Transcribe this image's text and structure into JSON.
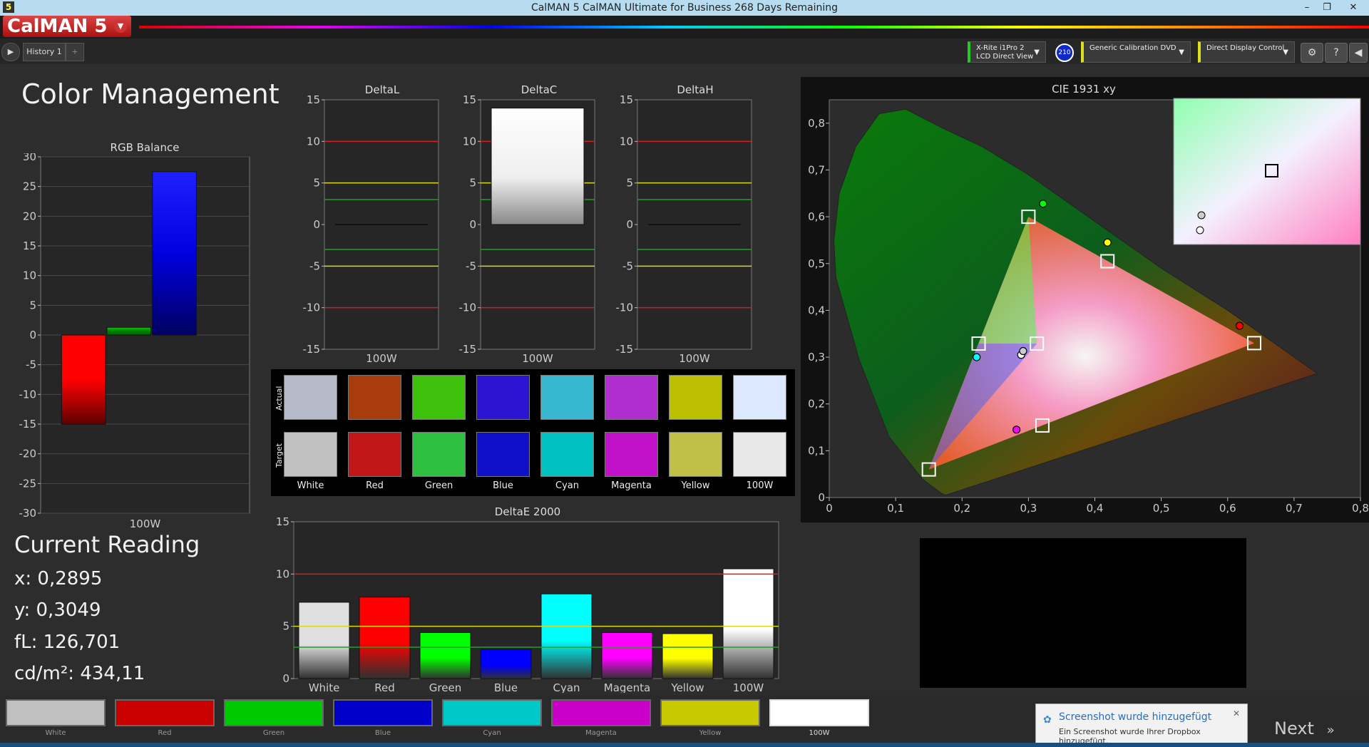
{
  "window": {
    "title": "CalMAN 5 CalMAN Ultimate for Business 268 Days Remaining",
    "app_icon": "5",
    "minimize": "–",
    "restore": "❐",
    "close": "✕"
  },
  "brand": {
    "logo": "CalMAN 5"
  },
  "tabs": {
    "history": "History 1",
    "add": "+"
  },
  "devices": [
    {
      "line1": "X-Rite i1Pro 2",
      "line2": "LCD Direct View",
      "accent": "#22cc22"
    },
    {
      "line1": "Generic Calibration DVD",
      "line2": "",
      "accent": "#dddd22"
    },
    {
      "line1": "Direct Display Control",
      "line2": "",
      "accent": "#dddd22"
    }
  ],
  "badge": "210",
  "page_title": "Color Management",
  "rgb_balance": {
    "title": "RGB Balance",
    "xlabel": "100W",
    "yticks": [
      "30",
      "25",
      "20",
      "15",
      "10",
      "5",
      "0",
      "-5",
      "-10",
      "-15",
      "-20",
      "-25",
      "-30"
    ]
  },
  "delta_charts": [
    {
      "title": "DeltaL",
      "xlabel": "100W"
    },
    {
      "title": "DeltaC",
      "xlabel": "100W"
    },
    {
      "title": "DeltaH",
      "xlabel": "100W"
    }
  ],
  "delta_yticks": [
    "15",
    "10",
    "5",
    "0",
    "-5",
    "-10",
    "-15"
  ],
  "swatch_rows": {
    "actual": "Actual",
    "target": "Target"
  },
  "swatches": [
    {
      "label": "White",
      "actual": "#b4bac8",
      "target": "#c0c0c0"
    },
    {
      "label": "Red",
      "actual": "#a83c0a",
      "target": "#c01818"
    },
    {
      "label": "Green",
      "actual": "#3ec20c",
      "target": "#2ec040"
    },
    {
      "label": "Blue",
      "actual": "#2a14d2",
      "target": "#1010c8"
    },
    {
      "label": "Cyan",
      "actual": "#38b8d0",
      "target": "#00c0c0"
    },
    {
      "label": "Magenta",
      "actual": "#b02ed0",
      "target": "#c010c8"
    },
    {
      "label": "Yellow",
      "actual": "#bcc000",
      "target": "#c0c048"
    },
    {
      "label": "100W",
      "actual": "#dce8ff",
      "target": "#e8e8e8"
    }
  ],
  "deltae": {
    "title": "DeltaE 2000",
    "yticks": [
      "15",
      "10",
      "5",
      "0"
    ]
  },
  "current_reading": {
    "title": "Current Reading",
    "x": "x: 0,2895",
    "y": "y: 0,3049",
    "fl": "fL: 126,701",
    "cdm2": "cd/m²: 434,11"
  },
  "cie": {
    "title": "CIE 1931 xy",
    "xticks": [
      "0",
      "0,1",
      "0,2",
      "0,3",
      "0,4",
      "0,5",
      "0,6",
      "0,7",
      "0,8"
    ],
    "yticks": [
      "0,8",
      "0,7",
      "0,6",
      "0,5",
      "0,4",
      "0,3",
      "0,2",
      "0,1",
      "0"
    ]
  },
  "footer_labels": [
    "White",
    "Red",
    "Green",
    "Blue",
    "Cyan",
    "Magenta",
    "Yellow",
    "100W"
  ],
  "footer_colors": [
    "#c0c0c0",
    "#c80000",
    "#00c800",
    "#0000c8",
    "#00c8c8",
    "#c800c8",
    "#c8c800",
    "#ffffff"
  ],
  "toast": {
    "title": "Screenshot wurde hinzugefügt",
    "body": "Ein Screenshot wurde Ihrer Dropbox hinzugefügt."
  },
  "next": "Next",
  "chart_data": [
    {
      "type": "bar",
      "title": "RGB Balance",
      "categories": [
        "100W"
      ],
      "series": [
        {
          "values": [
            -15
          ]
        },
        {
          "values": [
            1.3
          ]
        },
        {
          "values": [
            27.5
          ]
        }
      ],
      "series_colors": [
        "#ff0000",
        "#00a000",
        "#0000ff"
      ],
      "ylim": [
        -30,
        30
      ],
      "grid": true
    },
    {
      "type": "bar",
      "title": "DeltaL",
      "categories": [
        "100W"
      ],
      "values": [
        0
      ],
      "ylim": [
        -15,
        15
      ],
      "grid": true
    },
    {
      "type": "bar",
      "title": "DeltaC",
      "categories": [
        "100W"
      ],
      "values": [
        14
      ],
      "ylim": [
        -15,
        15
      ],
      "grid": true
    },
    {
      "type": "bar",
      "title": "DeltaH",
      "categories": [
        "100W"
      ],
      "values": [
        0
      ],
      "ylim": [
        -15,
        15
      ],
      "grid": true
    },
    {
      "type": "bar",
      "title": "DeltaE 2000",
      "categories": [
        "White",
        "Red",
        "Green",
        "Blue",
        "Cyan",
        "Magenta",
        "Yellow",
        "100W"
      ],
      "values": [
        7.3,
        7.8,
        4.4,
        2.8,
        8.1,
        4.4,
        4.3,
        10.5
      ],
      "colors": [
        "#e0e0e0",
        "#ff0000",
        "#00ff00",
        "#0000ff",
        "#00ffff",
        "#ff00ff",
        "#ffff00",
        "#ffffff"
      ],
      "ylim": [
        0,
        15
      ],
      "grid": true
    },
    {
      "type": "scatter",
      "title": "CIE 1931 xy",
      "xlim": [
        0,
        0.8
      ],
      "ylim": [
        0,
        0.85
      ],
      "targets": [
        [
          0.64,
          0.33
        ],
        [
          0.3,
          0.6
        ],
        [
          0.15,
          0.06
        ],
        [
          0.225,
          0.329
        ],
        [
          0.321,
          0.154
        ],
        [
          0.419,
          0.505
        ],
        [
          0.3127,
          0.329
        ]
      ],
      "actuals": [
        [
          0.618,
          0.367
        ],
        [
          0.322,
          0.628
        ],
        [
          0.222,
          0.3
        ],
        [
          0.282,
          0.145
        ],
        [
          0.419,
          0.545
        ],
        [
          0.289,
          0.305
        ],
        [
          0.292,
          0.313
        ]
      ],
      "actual_colors": [
        "#ff0000",
        "#00ff00",
        "#00ffff",
        "#ff00ff",
        "#ffff00",
        "#ffffff",
        "#cccccc"
      ]
    }
  ]
}
